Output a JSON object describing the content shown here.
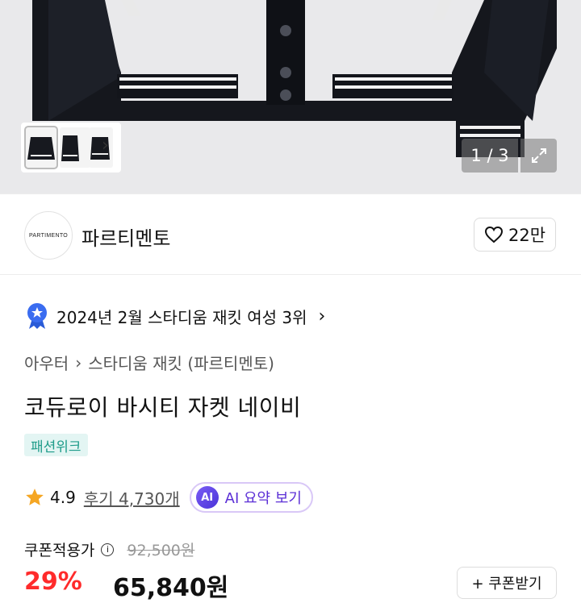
{
  "gallery": {
    "counter": "1 / 3",
    "thumb_next_glyph": "›",
    "icons": {
      "expand": "expand-icon",
      "next": "chevron-right-icon"
    }
  },
  "brand": {
    "logo_text": "PARTIMENTO",
    "name": "파르티멘토",
    "likes": "22만",
    "like_icon": "heart-outline-icon"
  },
  "ranking": {
    "text": "2024년 2월 스타디움 재킷 여성 3위",
    "icon": "award-badge-icon",
    "arrow": "›"
  },
  "breadcrumb": {
    "items": [
      "아우터",
      "스타디움 재킷 (파르티멘토)"
    ],
    "separator": "›"
  },
  "product": {
    "title": "코듀로이 바시티 자켓 네이비",
    "tag": "패션위크",
    "rating": "4.9",
    "reviews": "후기 4,730개",
    "ai_badge": "AI",
    "ai_summary": "AI 요약 보기",
    "star_color": "#f5a623"
  },
  "price": {
    "label": "쿠폰적용가",
    "info_glyph": "i",
    "original": "92,500원",
    "discount": "29%",
    "sale": "65,840원",
    "coupon_button": "+ 쿠폰받기",
    "discount_color": "#ff2b2b"
  }
}
